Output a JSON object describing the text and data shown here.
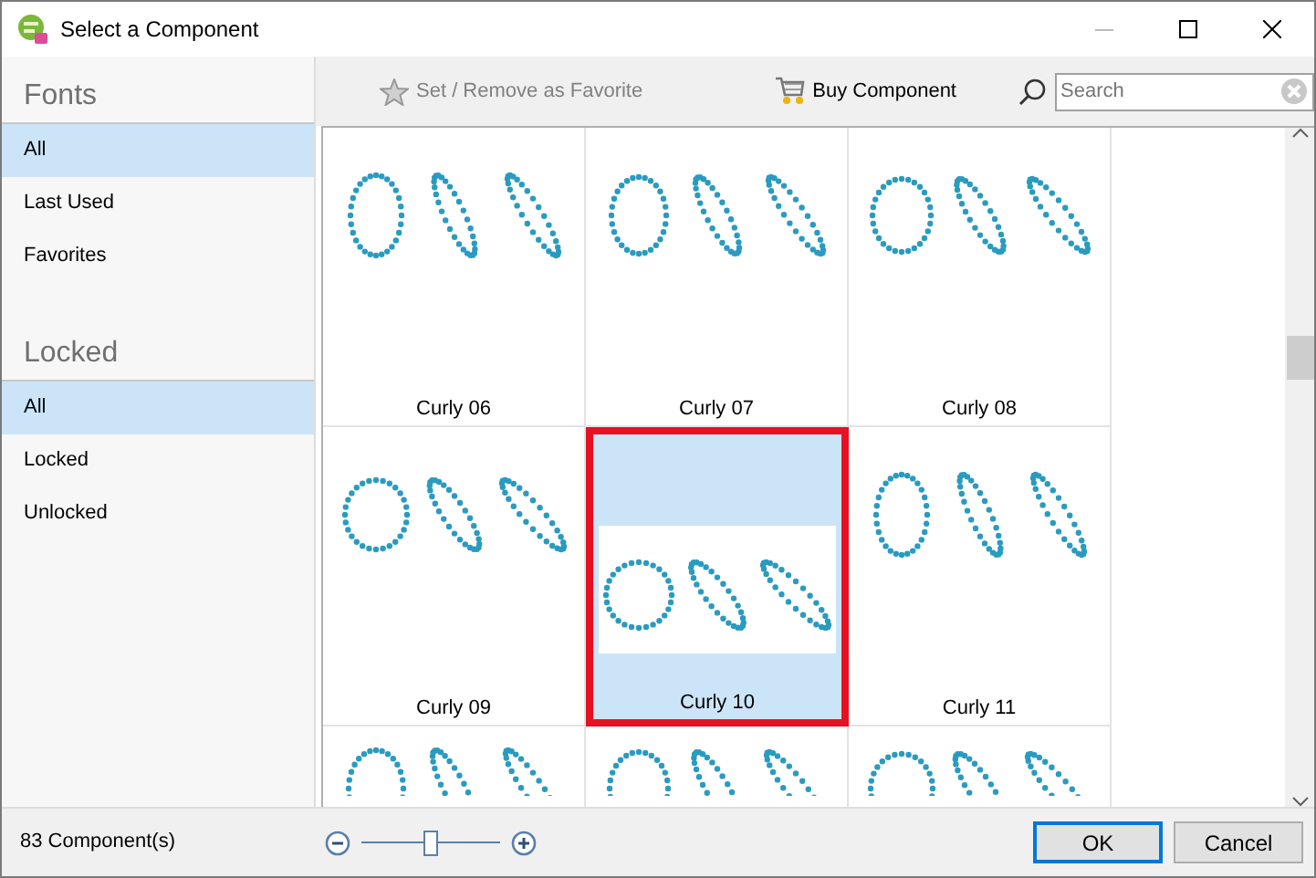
{
  "window": {
    "title": "Select a Component"
  },
  "sidebar": {
    "sections": [
      {
        "title": "Fonts",
        "items": [
          {
            "label": "All",
            "selected": true
          },
          {
            "label": "Last Used",
            "selected": false
          },
          {
            "label": "Favorites",
            "selected": false
          }
        ]
      },
      {
        "title": "Locked",
        "items": [
          {
            "label": "All",
            "selected": true
          },
          {
            "label": "Locked",
            "selected": false
          },
          {
            "label": "Unlocked",
            "selected": false
          }
        ]
      }
    ]
  },
  "toolbar": {
    "favorite_button": {
      "label": "Set / Remove as Favorite",
      "disabled": true
    },
    "buy_button": {
      "label": "Buy Component"
    },
    "search": {
      "placeholder": "Search"
    }
  },
  "grid": {
    "items": [
      {
        "label": "Curly 06",
        "selected": false
      },
      {
        "label": "Curly 07",
        "selected": false
      },
      {
        "label": "Curly 08",
        "selected": false
      },
      {
        "label": "Curly 09",
        "selected": false
      },
      {
        "label": "Curly 10",
        "selected": true
      },
      {
        "label": "Curly 11",
        "selected": false
      },
      {
        "selected": false
      },
      {
        "selected": false
      },
      {
        "selected": false
      }
    ]
  },
  "status": {
    "count": "83 Component(s)",
    "zoom": {
      "level": 0.5
    }
  },
  "buttons": [
    {
      "label": "OK",
      "default": true
    },
    {
      "label": "Cancel",
      "default": false
    }
  ]
}
